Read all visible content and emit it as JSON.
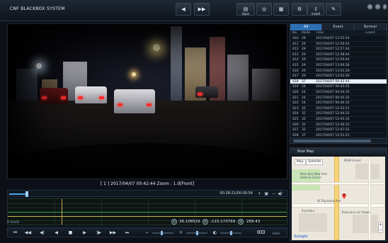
{
  "app": {
    "title": "CNF BLACKBOX SYSTEM"
  },
  "toolbar": {
    "buttons": [
      {
        "label": "",
        "icon": "prev-file-icon",
        "glyph": "◀"
      },
      {
        "label": "",
        "icon": "next-file-icon",
        "glyph": "▶▶"
      },
      {
        "label": "Open",
        "icon": "open-icon",
        "glyph": "▤"
      },
      {
        "label": "",
        "icon": "capture-icon",
        "glyph": "◎"
      },
      {
        "label": "",
        "icon": "print-icon",
        "glyph": "▦"
      },
      {
        "label": "",
        "icon": "settings-icon",
        "glyph": "⚙"
      },
      {
        "label": "Install",
        "icon": "install-icon",
        "glyph": "⇩"
      },
      {
        "label": "",
        "icon": "tools-icon",
        "glyph": "✎"
      }
    ]
  },
  "video": {
    "caption": "[ 1 ] 2017/04/07 00:42:44   Zoom : 1.0[Front]"
  },
  "seek": {
    "time": "00:28:21/00:00:54",
    "progress": 0.11
  },
  "gps": {
    "latitude": "36.108529",
    "longitude": "-115.173769",
    "altitude": "289.43",
    "speed_label": "0 km/h"
  },
  "display_counter": "033",
  "display_unit": "km/h",
  "file_panel": {
    "tabs": [
      "All",
      "Event",
      "Normal"
    ],
    "active_tab": 0,
    "columns": [
      "No",
      "Mode",
      "Time",
      "Count"
    ],
    "rows": [
      {
        "no": "410",
        "mode": "28",
        "time": "2017/04/07 12:55:54",
        "count": ""
      },
      {
        "no": "411",
        "mode": "29",
        "time": "2017/04/07 12:56:44",
        "count": ""
      },
      {
        "no": "412",
        "mode": "29",
        "time": "2017/04/07 12:57:44",
        "count": ""
      },
      {
        "no": "413",
        "mode": "29",
        "time": "2017/04/07 12:58:44",
        "count": ""
      },
      {
        "no": "414",
        "mode": "29",
        "time": "2017/04/07 12:59:44",
        "count": ""
      },
      {
        "no": "415",
        "mode": "29",
        "time": "2017/04/07 13:00:28",
        "count": ""
      },
      {
        "no": "416",
        "mode": "29",
        "time": "2017/04/07 13:01:29",
        "count": ""
      },
      {
        "no": "417",
        "mode": "29",
        "time": "2017/04/07 13:02:26",
        "count": ""
      },
      {
        "no": "418",
        "mode": "37",
        "time": "2017/04/07 00:42:44",
        "count": "",
        "selected": true
      },
      {
        "no": "419",
        "mode": "24",
        "time": "2017/04/07 00:43:35",
        "count": ""
      },
      {
        "no": "420",
        "mode": "24",
        "time": "2017/04/07 00:44:35",
        "count": ""
      },
      {
        "no": "421",
        "mode": "24",
        "time": "2017/04/07 00:45:35",
        "count": ""
      },
      {
        "no": "422",
        "mode": "24",
        "time": "2017/04/07 00:46:35",
        "count": ""
      },
      {
        "no": "423",
        "mode": "32",
        "time": "2017/04/07 12:43:31",
        "count": ""
      },
      {
        "no": "424",
        "mode": "32",
        "time": "2017/04/07 12:44:32",
        "count": ""
      },
      {
        "no": "425",
        "mode": "32",
        "time": "2017/04/07 12:45:32",
        "count": ""
      },
      {
        "no": "426",
        "mode": "32",
        "time": "2017/04/07 12:46:32",
        "count": ""
      },
      {
        "no": "427",
        "mode": "32",
        "time": "2017/04/07 12:47:32",
        "count": ""
      },
      {
        "no": "428",
        "mode": "37",
        "time": "2017/04/07 12:51:21",
        "count": ""
      }
    ]
  },
  "map": {
    "title": "Now Map",
    "controls": [
      "Map",
      "Satellite"
    ],
    "labels": {
      "l1": "New York-New York Hotel & Casino",
      "l2": "W Tropicana Ave",
      "l3": "Excalibur",
      "l4": "Tropicana Las Vegas",
      "l5": "MGM Grand"
    },
    "logo": "Google"
  }
}
